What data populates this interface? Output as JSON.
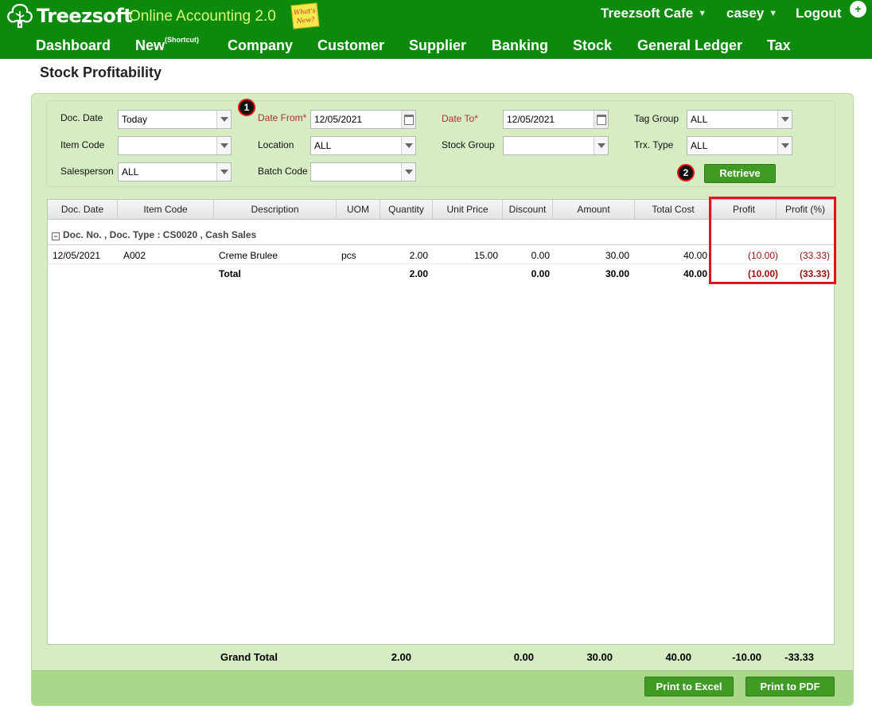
{
  "app": {
    "logo_text": "Treezsoft",
    "subtitle": "Online Accounting 2.0",
    "whats_new": "What's New?",
    "company": "Treezsoft Cafe",
    "user": "casey",
    "logout": "Logout",
    "user_icon": "person-add-icon"
  },
  "nav": {
    "dashboard": "Dashboard",
    "new": "New",
    "new_shortcut": "(Shortcut)",
    "company": "Company",
    "customer": "Customer",
    "supplier": "Supplier",
    "banking": "Banking",
    "stock": "Stock",
    "general_ledger": "General Ledger",
    "tax": "Tax"
  },
  "page": {
    "title": "Stock Profitability"
  },
  "filters": {
    "doc_date_label": "Doc. Date",
    "doc_date_value": "Today",
    "item_code_label": "Item Code",
    "item_code_value": "",
    "salesperson_label": "Salesperson",
    "salesperson_value": "ALL",
    "date_from_label": "Date From*",
    "date_from_value": "12/05/2021",
    "location_label": "Location",
    "location_value": "ALL",
    "batch_code_label": "Batch Code",
    "batch_code_value": "",
    "date_to_label": "Date To*",
    "date_to_value": "12/05/2021",
    "stock_group_label": "Stock Group",
    "stock_group_value": "",
    "tag_group_label": "Tag Group",
    "tag_group_value": "ALL",
    "trx_type_label": "Trx. Type",
    "trx_type_value": "ALL",
    "retrieve_label": "Retrieve",
    "marker_1": "1",
    "marker_2": "2"
  },
  "table": {
    "columns": [
      "Doc. Date",
      "Item Code",
      "Description",
      "UOM",
      "Quantity",
      "Unit Price",
      "Discount",
      "Amount",
      "Total Cost",
      "Profit",
      "Profit (%)"
    ],
    "group_label": "Doc. No. , Doc. Type : CS0020 , Cash Sales",
    "rows": [
      {
        "doc_date": "12/05/2021",
        "item_code": "A002",
        "description": "Creme Brulee",
        "uom": "pcs",
        "quantity": "2.00",
        "unit_price": "15.00",
        "discount": "0.00",
        "amount": "30.00",
        "total_cost": "40.00",
        "profit": "(10.00)",
        "profit_pct": "(33.33)"
      }
    ],
    "total": {
      "label": "Total",
      "quantity": "2.00",
      "discount": "0.00",
      "amount": "30.00",
      "total_cost": "40.00",
      "profit": "(10.00)",
      "profit_pct": "(33.33)"
    }
  },
  "grand_total": {
    "label": "Grand Total",
    "quantity": "2.00",
    "discount": "0.00",
    "amount": "30.00",
    "total_cost": "40.00",
    "profit": "-10.00",
    "profit_pct": "-33.33"
  },
  "footer": {
    "print_excel": "Print to Excel",
    "print_pdf": "Print to PDF"
  },
  "colors": {
    "header_green": "#0b8a0b",
    "panel_green": "#d6ecc3",
    "footer_green": "#a9d88a",
    "button_green": "#3f9b23",
    "highlight_red": "#e3141f",
    "negative_red": "#a01010"
  }
}
